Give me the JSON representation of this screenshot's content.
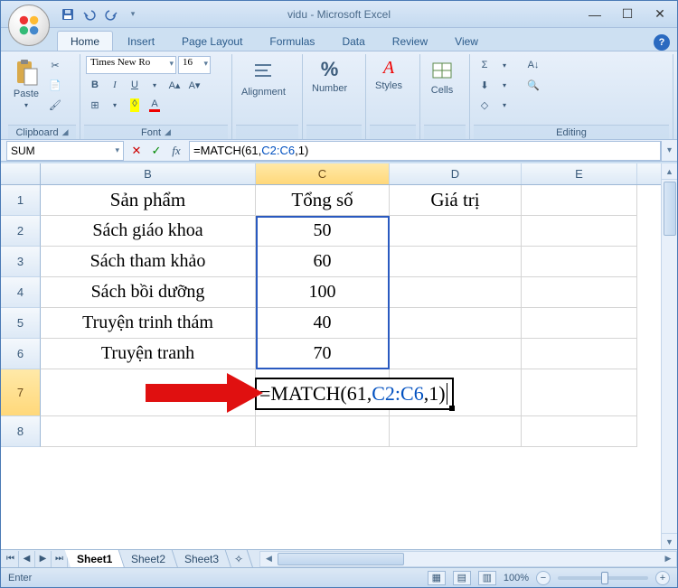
{
  "title": "vidu - Microsoft Excel",
  "tabs": [
    "Home",
    "Insert",
    "Page Layout",
    "Formulas",
    "Data",
    "Review",
    "View"
  ],
  "active_tab": "Home",
  "ribbon": {
    "clipboard_label": "Clipboard",
    "paste_label": "Paste",
    "font_label": "Font",
    "font_name": "Times New Ro",
    "font_size": "16",
    "alignment_label": "Alignment",
    "number_label": "Number",
    "styles_label": "Styles",
    "cells_label": "Cells",
    "editing_label": "Editing",
    "percent_sym": "%"
  },
  "formula_bar": {
    "namebox": "SUM",
    "formula_prefix": "=MATCH(61,",
    "formula_ref": "C2:C6",
    "formula_suffix": ",1)"
  },
  "columns": [
    "B",
    "C",
    "D",
    "E"
  ],
  "col_widths": {
    "B": 238,
    "C": 148,
    "D": 146,
    "E": 128
  },
  "row_heads": [
    "1",
    "2",
    "3",
    "4",
    "5",
    "6",
    "7",
    "8"
  ],
  "header_row": {
    "B": "Sản phẩm",
    "C": "Tổng số",
    "D": "Giá trị"
  },
  "data_rows": [
    {
      "B": "Sách giáo khoa",
      "C": "50"
    },
    {
      "B": "Sách tham khảo",
      "C": "60"
    },
    {
      "B": "Sách bồi dưỡng",
      "C": "100"
    },
    {
      "B": "Truyện trinh thám",
      "C": "40"
    },
    {
      "B": "Truyện tranh",
      "C": "70"
    }
  ],
  "editing_cell": {
    "row": 7,
    "col": "C",
    "prefix": "=MATCH(61,",
    "ref": "C2:C6",
    "suffix": ",1)"
  },
  "selected_range": "C2:C6",
  "sheet_tabs": [
    "Sheet1",
    "Sheet2",
    "Sheet3"
  ],
  "active_sheet": "Sheet1",
  "status": {
    "mode": "Enter",
    "zoom": "100%"
  },
  "colors": {
    "accent": "#2a5ac0",
    "arrow": "#e01010"
  }
}
